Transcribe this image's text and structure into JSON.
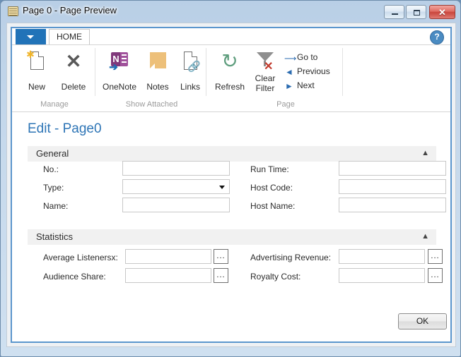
{
  "window": {
    "title": "Page 0 - Page Preview",
    "icon": "table-icon",
    "minimize_label": "–",
    "maximize_label": "□",
    "close_label": "✕"
  },
  "ribbon": {
    "app_menu_label": "",
    "tabs": [
      {
        "label": "HOME",
        "active": true
      }
    ],
    "help_label": "?",
    "groups": [
      {
        "name": "Manage",
        "items": [
          {
            "label": "New",
            "icon": "new-document-icon"
          },
          {
            "label": "Delete",
            "icon": "delete-x-icon"
          }
        ]
      },
      {
        "name": "Show Attached",
        "items": [
          {
            "label": "OneNote",
            "icon": "onenote-icon"
          },
          {
            "label": "Notes",
            "icon": "notes-icon"
          },
          {
            "label": "Links",
            "icon": "links-icon"
          }
        ]
      },
      {
        "name": "Page",
        "items": [
          {
            "label": "Refresh",
            "icon": "refresh-icon"
          },
          {
            "label": "Clear Filter",
            "label_line1": "Clear",
            "label_line2": "Filter",
            "icon": "clear-filter-icon"
          }
        ],
        "nav_items": [
          {
            "label": "Go to",
            "icon": "arrow-right-icon"
          },
          {
            "label": "Previous",
            "icon": "arrow-left-icon"
          },
          {
            "label": "Next",
            "icon": "arrow-right-solid-icon"
          }
        ]
      }
    ]
  },
  "page": {
    "title": "Edit - Page0",
    "sections": [
      {
        "name": "General",
        "collapse_icon": "chevron-up-icon",
        "fields_left": [
          {
            "label": "No.:",
            "value": "",
            "type": "text"
          },
          {
            "label": "Type:",
            "value": "",
            "type": "dropdown"
          },
          {
            "label": "Name:",
            "value": "",
            "type": "text"
          }
        ],
        "fields_right": [
          {
            "label": "Run Time:",
            "value": "",
            "type": "text"
          },
          {
            "label": "Host Code:",
            "value": "",
            "type": "text"
          },
          {
            "label": "Host Name:",
            "value": "",
            "type": "text"
          }
        ]
      },
      {
        "name": "Statistics",
        "collapse_icon": "chevron-up-icon",
        "fields_left": [
          {
            "label": "Average Listenersx:",
            "value": "",
            "type": "assist",
            "assist_label": "..."
          },
          {
            "label": "Audience Share:",
            "value": "",
            "type": "assist",
            "assist_label": "..."
          }
        ],
        "fields_right": [
          {
            "label": "Advertising Revenue:",
            "value": "",
            "type": "assist",
            "assist_label": "..."
          },
          {
            "label": "Royalty Cost:",
            "value": "",
            "type": "assist",
            "assist_label": "..."
          }
        ]
      }
    ],
    "ok_label": "OK"
  },
  "colors": {
    "title_accent": "#2e75b6",
    "frame_border": "#5b96cd",
    "app_button": "#2173b8",
    "section_bg": "#f1f1f1",
    "close_button": "#c8453c"
  }
}
